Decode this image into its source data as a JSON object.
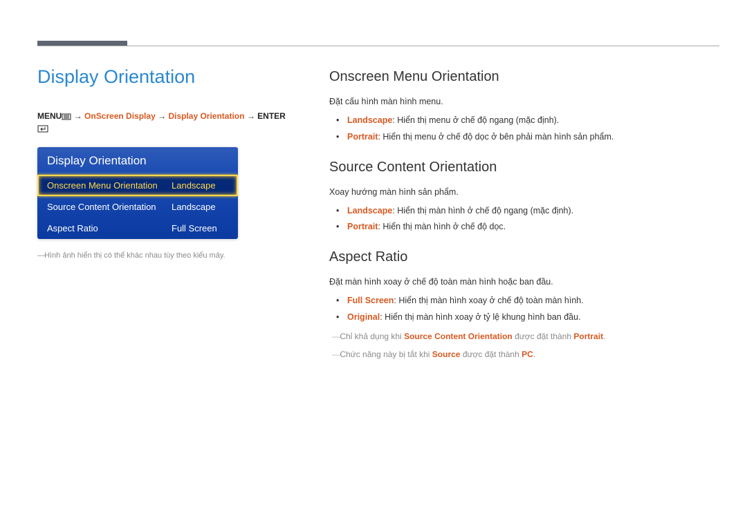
{
  "title": "Display Orientation",
  "breadcrumb": {
    "menu": "MENU",
    "path1": "OnScreen Display",
    "path2": "Display Orientation",
    "enter": "ENTER",
    "arrow": " → "
  },
  "osd": {
    "title": "Display Orientation",
    "rows": [
      {
        "label": "Onscreen Menu Orientation",
        "value": "Landscape",
        "selected": true
      },
      {
        "label": "Source Content Orientation",
        "value": "Landscape",
        "selected": false
      },
      {
        "label": "Aspect Ratio",
        "value": "Full Screen",
        "selected": false
      }
    ]
  },
  "left_note": "Hình ảnh hiển thị có thể khác nhau tùy theo kiểu máy.",
  "sections": {
    "s1": {
      "heading": "Onscreen Menu Orientation",
      "intro": "Đặt cấu hình màn hình menu.",
      "items": [
        {
          "term": "Landscape",
          "desc": ": Hiển thị menu ở chế độ ngang (mặc định)."
        },
        {
          "term": "Portrait",
          "desc": ": Hiển thị menu ở chế độ dọc ở bên phải màn hình sản phẩm."
        }
      ]
    },
    "s2": {
      "heading": "Source Content Orientation",
      "intro": "Xoay hướng màn hình sản phẩm.",
      "items": [
        {
          "term": "Landscape",
          "desc": ": Hiển thị màn hình ở chế độ ngang (mặc định)."
        },
        {
          "term": "Portrait",
          "desc": ": Hiển thị màn hình ở chế độ dọc."
        }
      ]
    },
    "s3": {
      "heading": "Aspect Ratio",
      "intro": "Đặt màn hình xoay ở chế độ toàn màn hình hoặc ban đầu.",
      "items": [
        {
          "term": "Full Screen",
          "desc": ": Hiển thị màn hình xoay ở chế độ toàn màn hình."
        },
        {
          "term": "Original",
          "desc": ": Hiển thị màn hình xoay ở tỷ lệ khung hình ban đầu."
        }
      ],
      "notes": [
        {
          "pre": "Chỉ khả dụng khi ",
          "t1": "Source Content Orientation",
          "mid": " được đặt thành ",
          "t2": "Portrait",
          "post": "."
        },
        {
          "pre": "Chức năng này bị tắt khi ",
          "t1": "Source",
          "mid": " được đặt thành ",
          "t2": "PC",
          "post": "."
        }
      ]
    }
  }
}
